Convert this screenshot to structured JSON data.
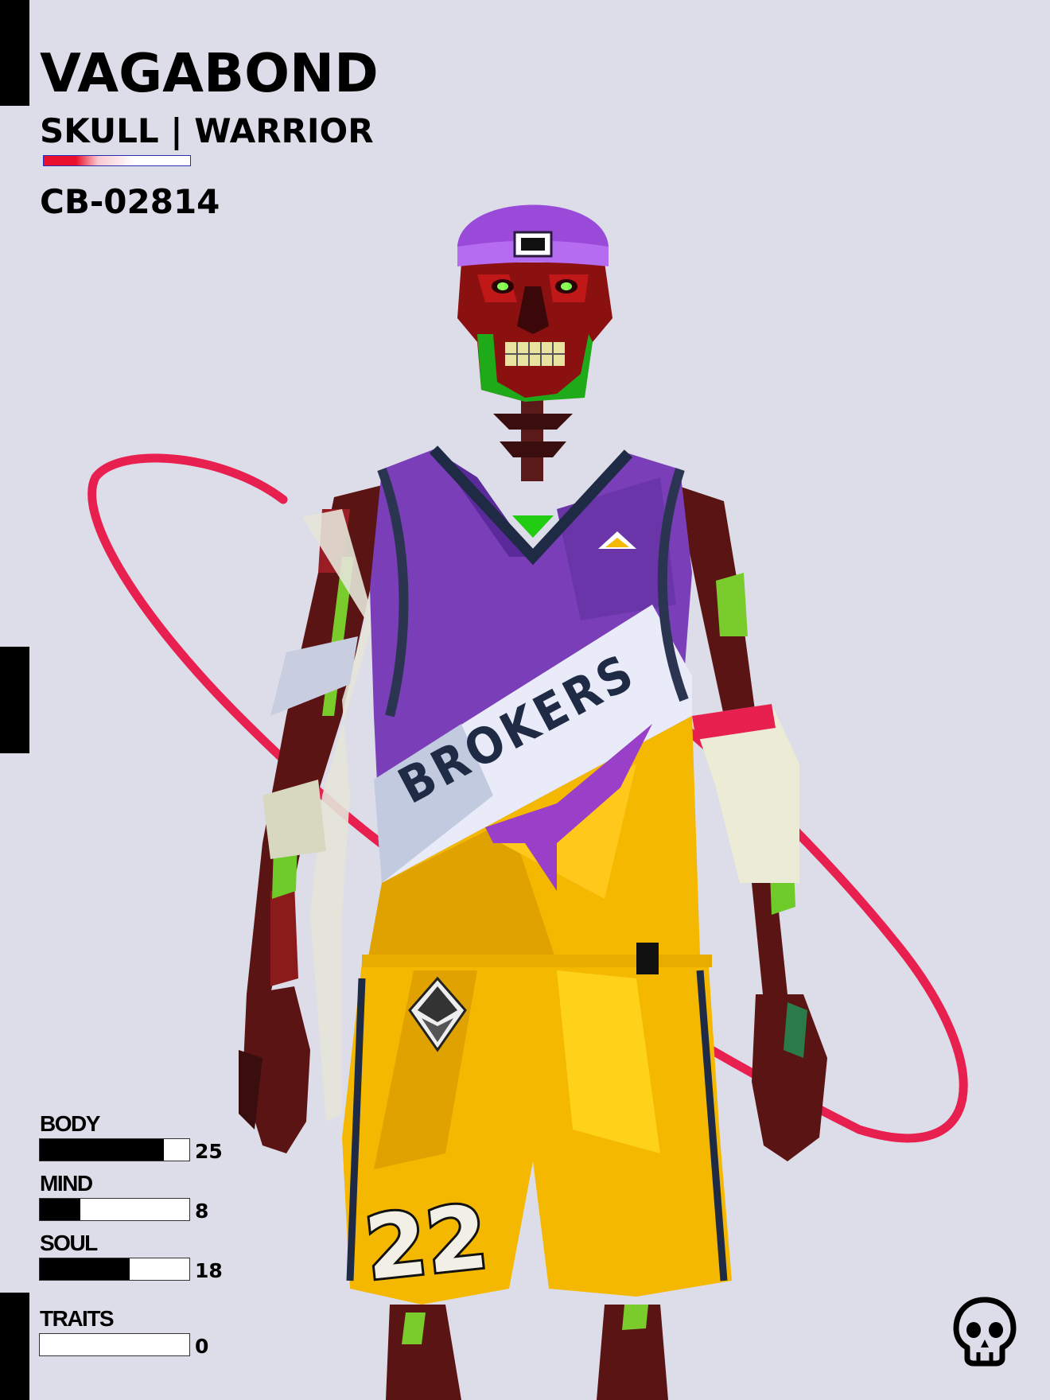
{
  "card": {
    "name": "VAGABOND",
    "class": "SKULL | WARRIOR",
    "id": "CB-02814",
    "rarity_level": 0.22
  },
  "character": {
    "jersey_team": "BROKERS",
    "shorts_number": "22"
  },
  "stats": [
    {
      "label": "BODY",
      "value": "25",
      "level": 0.83
    },
    {
      "label": "MIND",
      "value": "8",
      "level": 0.27
    },
    {
      "label": "SOUL",
      "value": "18",
      "level": 0.6
    },
    {
      "label": "TRAITS",
      "value": "0",
      "level": 0
    }
  ],
  "colors": {
    "background": "#dddde9",
    "accent_red": "#e8102a",
    "orbit_pink": "#e8204f",
    "jersey_purple": "#7a3fb8",
    "jersey_yellow": "#f5b800",
    "skull_red": "#8b1010",
    "skull_green": "#1faa1a"
  },
  "icons": {
    "logo": "skull-icon",
    "chest_badge": "triangle-icon",
    "shorts_badge": "ethereum-icon"
  }
}
